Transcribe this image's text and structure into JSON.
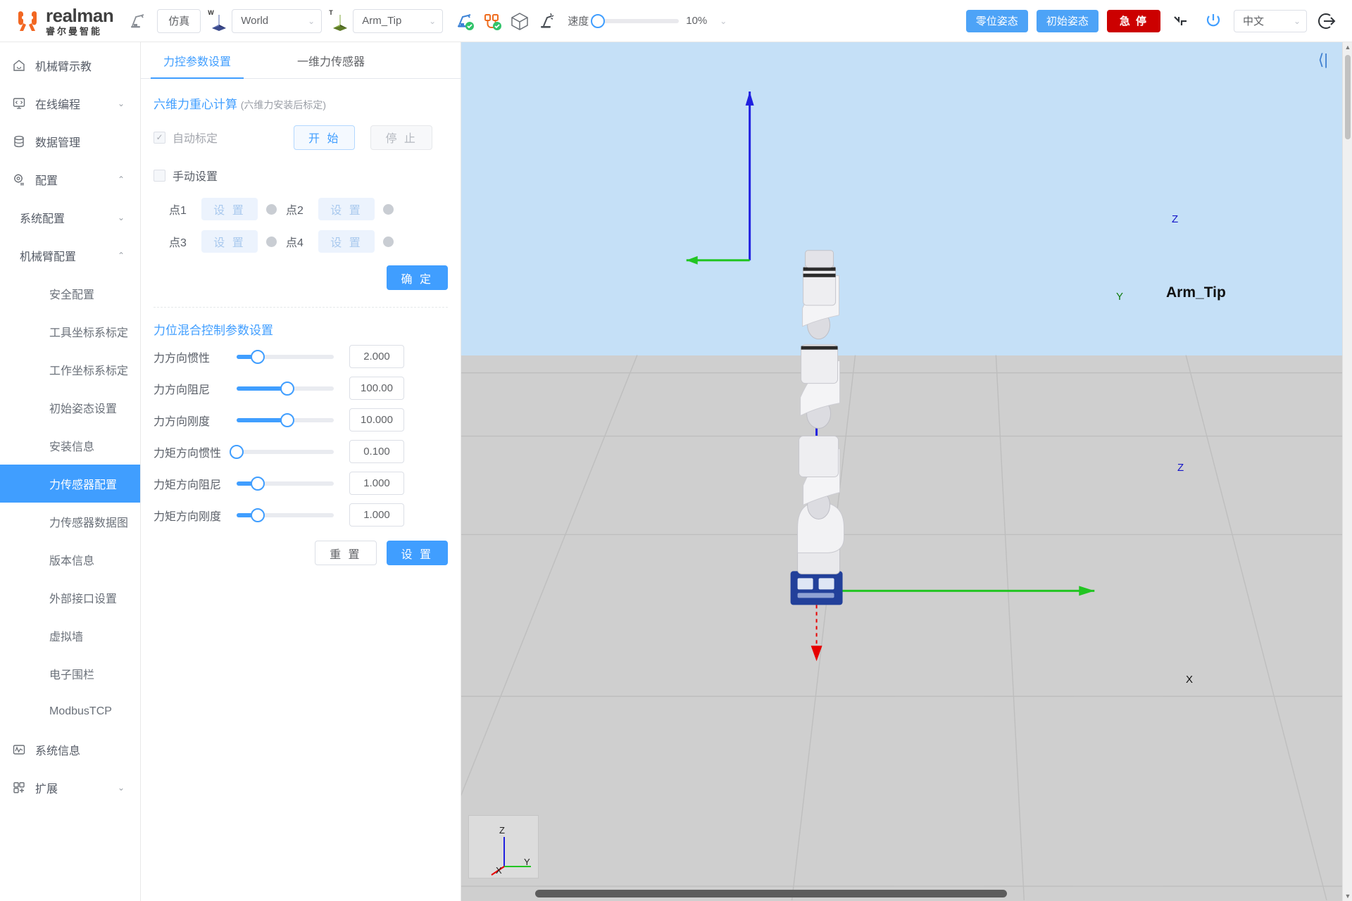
{
  "topbar": {
    "brand_name": "realman",
    "brand_sub": "睿尔曼智能",
    "teach_icon": "robot-arm-icon",
    "mode_button": "仿真",
    "world_badge_label": "W",
    "world_frame": "World",
    "tool_badge_label": "T",
    "tool_frame": "Arm_Tip",
    "status_icons": [
      {
        "name": "arm-connected-icon",
        "label": "机械臂连接"
      },
      {
        "name": "cable-connected-icon",
        "label": "控制器连接"
      },
      {
        "name": "collision-cube-icon",
        "label": "碰撞检测"
      },
      {
        "name": "drag-teach-icon",
        "label": "拖动示教"
      }
    ],
    "speed_label": "速度",
    "speed_value": "10%",
    "speed_percent": 3,
    "zero_pose_button": "零位姿态",
    "init_pose_button": "初始姿态",
    "estop_button": "急 停",
    "reset_icon": "joint-reset-icon",
    "power_icon": "power-icon",
    "language": "中文",
    "logout_icon": "logout-icon"
  },
  "sidebar": {
    "items": [
      {
        "label": "机械臂示教",
        "icon": "home-icon",
        "type": "item",
        "arrow": "",
        "active": false
      },
      {
        "label": "在线编程",
        "icon": "code-icon",
        "type": "item",
        "arrow": "⌄",
        "active": false
      },
      {
        "label": "数据管理",
        "icon": "database-icon",
        "type": "item",
        "arrow": "",
        "active": false
      },
      {
        "label": "配置",
        "icon": "gear-icon",
        "type": "item",
        "arrow": "⌃",
        "active": false
      },
      {
        "label": "系统配置",
        "icon": "",
        "type": "sub",
        "arrow": "⌄",
        "active": false
      },
      {
        "label": "机械臂配置",
        "icon": "",
        "type": "sub",
        "arrow": "⌃",
        "active": false
      },
      {
        "label": "安全配置",
        "icon": "",
        "type": "leaf",
        "arrow": "",
        "active": false
      },
      {
        "label": "工具坐标系标定",
        "icon": "",
        "type": "leaf",
        "arrow": "",
        "active": false
      },
      {
        "label": "工作坐标系标定",
        "icon": "",
        "type": "leaf",
        "arrow": "",
        "active": false
      },
      {
        "label": "初始姿态设置",
        "icon": "",
        "type": "leaf",
        "arrow": "",
        "active": false
      },
      {
        "label": "安装信息",
        "icon": "",
        "type": "leaf",
        "arrow": "",
        "active": false
      },
      {
        "label": "力传感器配置",
        "icon": "",
        "type": "leaf",
        "arrow": "",
        "active": true
      },
      {
        "label": "力传感器数据图",
        "icon": "",
        "type": "leaf",
        "arrow": "",
        "active": false
      },
      {
        "label": "版本信息",
        "icon": "",
        "type": "leaf",
        "arrow": "",
        "active": false
      },
      {
        "label": "外部接口设置",
        "icon": "",
        "type": "leaf",
        "arrow": "",
        "active": false
      },
      {
        "label": "虚拟墙",
        "icon": "",
        "type": "leaf",
        "arrow": "",
        "active": false
      },
      {
        "label": "电子围栏",
        "icon": "",
        "type": "leaf",
        "arrow": "",
        "active": false
      },
      {
        "label": "ModbusTCP",
        "icon": "",
        "type": "leaf",
        "arrow": "",
        "active": false
      },
      {
        "label": "系统信息",
        "icon": "wave-icon",
        "type": "item",
        "arrow": "",
        "active": false
      },
      {
        "label": "扩展",
        "icon": "grid-icon",
        "type": "item",
        "arrow": "⌄",
        "active": false
      }
    ]
  },
  "panel": {
    "tabs": [
      {
        "label": "力控参数设置",
        "active": true
      },
      {
        "label": "一维力传感器",
        "active": false
      }
    ],
    "calibration": {
      "title": "六维力重心计算",
      "note": "(六维力安装后标定)",
      "auto_label": "自动标定",
      "auto_checked": true,
      "start_button": "开 始",
      "stop_button": "停 止",
      "manual_label": "手动设置",
      "manual_checked": false,
      "points": [
        {
          "label": "点1",
          "button": "设 置"
        },
        {
          "label": "点2",
          "button": "设 置"
        },
        {
          "label": "点3",
          "button": "设 置"
        },
        {
          "label": "点4",
          "button": "设 置"
        }
      ],
      "confirm_button": "确 定"
    },
    "hybrid": {
      "title": "力位混合控制参数设置",
      "params": [
        {
          "label": "力方向惯性",
          "value": "2.000",
          "percent": 22
        },
        {
          "label": "力方向阻尼",
          "value": "100.00",
          "percent": 52
        },
        {
          "label": "力方向刚度",
          "value": "10.000",
          "percent": 52
        },
        {
          "label": "力矩方向惯性",
          "value": "0.100",
          "percent": 0
        },
        {
          "label": "力矩方向阻尼",
          "value": "1.000",
          "percent": 22
        },
        {
          "label": "力矩方向刚度",
          "value": "1.000",
          "percent": 22
        }
      ],
      "reset_button": "重 置",
      "set_button": "设 置"
    }
  },
  "viewport": {
    "collapse_icon": "collapse-panel-icon",
    "tooltip_label": "Arm_Tip",
    "world_axis_z": "Z",
    "world_axis_y": "Y",
    "world_axis_x": "X",
    "tool_axis_z": "Z",
    "mini_axis_z": "Z",
    "mini_axis_y": "Y",
    "mini_axis_x": "X",
    "colors": {
      "sky": "#c5e0f7",
      "ground": "#cfcfcf",
      "axis_x": "#e60000",
      "axis_y": "#22c522",
      "axis_z": "#2020e0",
      "accent": "#409eff",
      "danger": "#cc0000"
    }
  }
}
